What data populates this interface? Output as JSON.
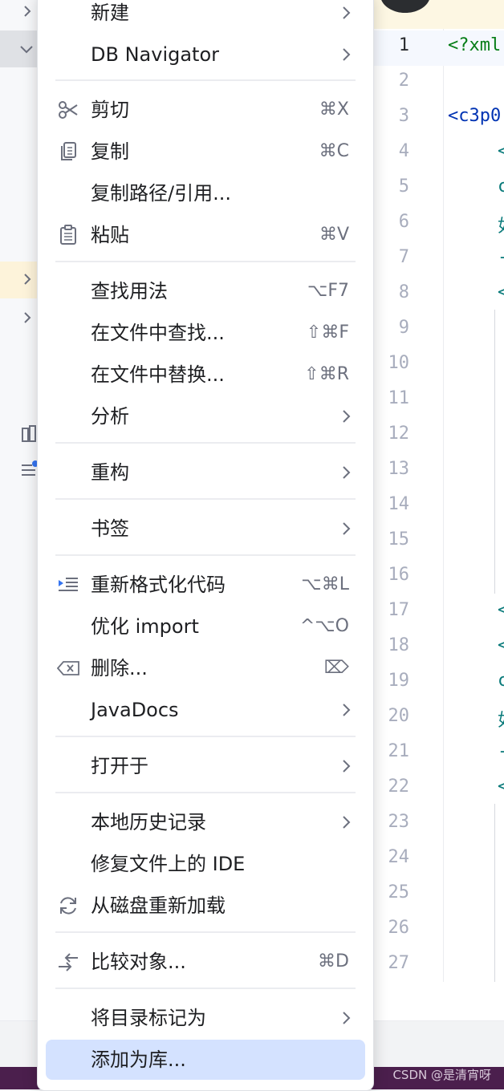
{
  "menu": {
    "items": [
      {
        "label": "新建",
        "shortcut": "",
        "submenu": true,
        "icon": ""
      },
      {
        "label": "DB Navigator",
        "shortcut": "",
        "submenu": true,
        "icon": ""
      },
      {
        "label": "剪切",
        "shortcut": "⌘X",
        "submenu": false,
        "icon": "scissors-icon"
      },
      {
        "label": "复制",
        "shortcut": "⌘C",
        "submenu": false,
        "icon": "copy-icon"
      },
      {
        "label": "复制路径/引用...",
        "shortcut": "",
        "submenu": false,
        "icon": ""
      },
      {
        "label": "粘贴",
        "shortcut": "⌘V",
        "submenu": false,
        "icon": "clipboard-icon"
      },
      {
        "label": "查找用法",
        "shortcut": "⌥F7",
        "submenu": false,
        "icon": ""
      },
      {
        "label": "在文件中查找...",
        "shortcut": "⇧⌘F",
        "submenu": false,
        "icon": ""
      },
      {
        "label": "在文件中替换...",
        "shortcut": "⇧⌘R",
        "submenu": false,
        "icon": ""
      },
      {
        "label": "分析",
        "shortcut": "",
        "submenu": true,
        "icon": ""
      },
      {
        "label": "重构",
        "shortcut": "",
        "submenu": true,
        "icon": ""
      },
      {
        "label": "书签",
        "shortcut": "",
        "submenu": true,
        "icon": ""
      },
      {
        "label": "重新格式化代码",
        "shortcut": "⌥⌘L",
        "submenu": false,
        "icon": "reformat-icon"
      },
      {
        "label": "优化 import",
        "shortcut": "^⌥O",
        "submenu": false,
        "icon": ""
      },
      {
        "label": "删除...",
        "shortcut": "⌦",
        "submenu": false,
        "icon": "delete-key-icon"
      },
      {
        "label": "JavaDocs",
        "shortcut": "",
        "submenu": true,
        "icon": ""
      },
      {
        "label": "打开于",
        "shortcut": "",
        "submenu": true,
        "icon": ""
      },
      {
        "label": "本地历史记录",
        "shortcut": "",
        "submenu": true,
        "icon": ""
      },
      {
        "label": "修复文件上的 IDE",
        "shortcut": "",
        "submenu": false,
        "icon": ""
      },
      {
        "label": "从磁盘重新加载",
        "shortcut": "",
        "submenu": false,
        "icon": "reload-icon"
      },
      {
        "label": "比较对象...",
        "shortcut": "⌘D",
        "submenu": false,
        "icon": "compare-icon"
      },
      {
        "label": "将目录标记为",
        "shortcut": "",
        "submenu": true,
        "icon": ""
      },
      {
        "label": "添加为库...",
        "shortcut": "",
        "submenu": false,
        "icon": "",
        "selected": true
      }
    ]
  },
  "editor": {
    "line_numbers": [
      "1",
      "2",
      "3",
      "4",
      "5",
      "6",
      "7",
      "8",
      "9",
      "10",
      "11",
      "12",
      "13",
      "14",
      "15",
      "16",
      "17",
      "18",
      "19",
      "20",
      "21",
      "22",
      "23",
      "24",
      "25",
      "26",
      "27"
    ],
    "current_line": "1",
    "code": {
      "l1": "<?xml",
      "l3": "<c3p0",
      "l4": "<",
      "l5": "c",
      "l6": "如",
      "l7": "-",
      "l8": "<",
      "l17": "<",
      "l18": "<",
      "l19": "c",
      "l20": "如",
      "l21": "-",
      "l22": "<"
    }
  },
  "status": {
    "watermark": "CSDN @是清宵呀"
  },
  "colors": {
    "selection": "#d4e2ff",
    "status_bar": "#4b1f4d",
    "code_tag": "#0033b3",
    "code_green": "#067d17",
    "code_teal": "#0b7b7b"
  }
}
